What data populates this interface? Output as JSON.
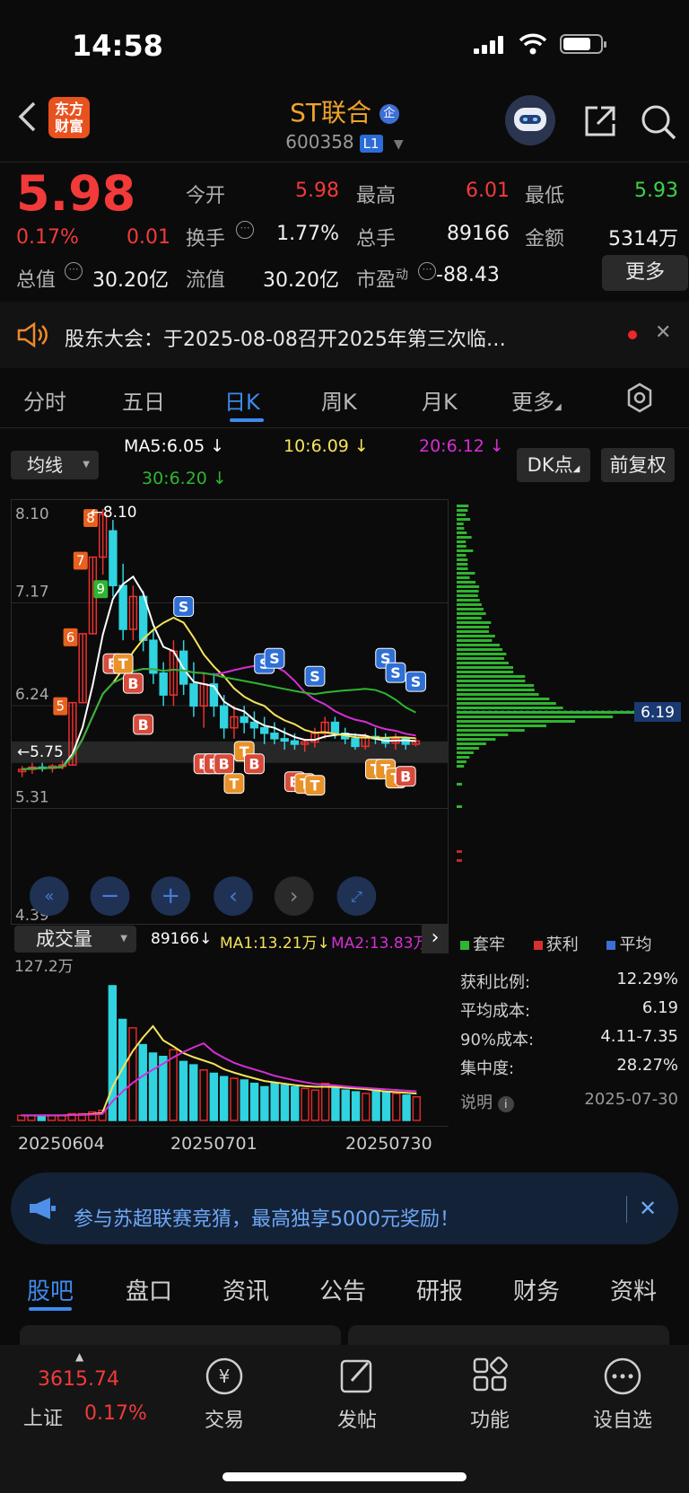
{
  "status_bar": {
    "time": "14:58"
  },
  "header": {
    "title": "ST联合",
    "badge": "企",
    "code": "600358",
    "level": "L1"
  },
  "quote": {
    "price": "5.98",
    "change_pct": "0.17%",
    "change": "0.01",
    "open_label": "今开",
    "open": "5.98",
    "high_label": "最高",
    "high": "6.01",
    "low_label": "最低",
    "low": "5.93",
    "turnover_label": "换手",
    "turnover": "1.77%",
    "volume_label": "总手",
    "volume": "89166",
    "amount_label": "金额",
    "amount": "5314万",
    "mktcap_label": "总值",
    "mktcap": "30.20亿",
    "float_label": "流值",
    "float": "30.20亿",
    "pe_label": "市盈",
    "pe_sup": "动",
    "pe": "-88.43",
    "more": "更多"
  },
  "notice": {
    "text": "股东大会：于2025-08-08召开2025年第三次临…"
  },
  "period_tabs": [
    "分时",
    "五日",
    "日K",
    "周K",
    "月K",
    "更多"
  ],
  "period_active": "日K",
  "ma": {
    "selector": "均线",
    "ma5": "MA5:6.05",
    "ma10": "10:6.09",
    "ma20": "20:6.12",
    "ma30": "30:6.20",
    "dk_button": "DK点",
    "adjust_button": "前复权",
    "colors": {
      "ma5": "#ffffff",
      "ma10": "#f5e35a",
      "ma20": "#d62ed6",
      "ma30": "#2fb52f"
    }
  },
  "chart_data": {
    "type": "candlestick",
    "y_ticks": [
      "8.10",
      "7.17",
      "6.24",
      "5.31",
      "4.39"
    ],
    "ylim": [
      4.39,
      8.1
    ],
    "high_marker": "8.10",
    "low_marker": "5.75",
    "chips_avg": "6.19",
    "x_ticks": [
      "20250604",
      "20250701",
      "20250730"
    ],
    "limit_up_counts": [
      "5",
      "6",
      "7",
      "8",
      "9"
    ],
    "signals": [
      "B",
      "T",
      "S"
    ],
    "volume": {
      "selector": "成交量",
      "current": "89166",
      "ma1": "MA1:13.21万",
      "ma2": "MA2:13.83万",
      "max_label": "127.2万"
    }
  },
  "chips": {
    "legend": [
      "套牢",
      "获利",
      "平均"
    ],
    "profit_ratio_label": "获利比例:",
    "profit_ratio": "12.29%",
    "avg_cost_label": "平均成本:",
    "avg_cost": "6.19",
    "cost90_label": "90%成本:",
    "cost90": "4.11-7.35",
    "concentration_label": "集中度:",
    "concentration": "28.27%",
    "explain": "说明",
    "date": "2025-07-30"
  },
  "banner": {
    "text": "参与苏超联赛竞猜，最高独享5000元奖励！"
  },
  "bottom_tabs": [
    "股吧",
    "盘口",
    "资讯",
    "公告",
    "研报",
    "财务",
    "资料"
  ],
  "bottom_nav": {
    "index_value": "3615.74",
    "index_name": "上证",
    "index_change": "0.17%",
    "items": [
      "交易",
      "发帖",
      "功能",
      "设自选"
    ]
  },
  "logo": "东方财富"
}
